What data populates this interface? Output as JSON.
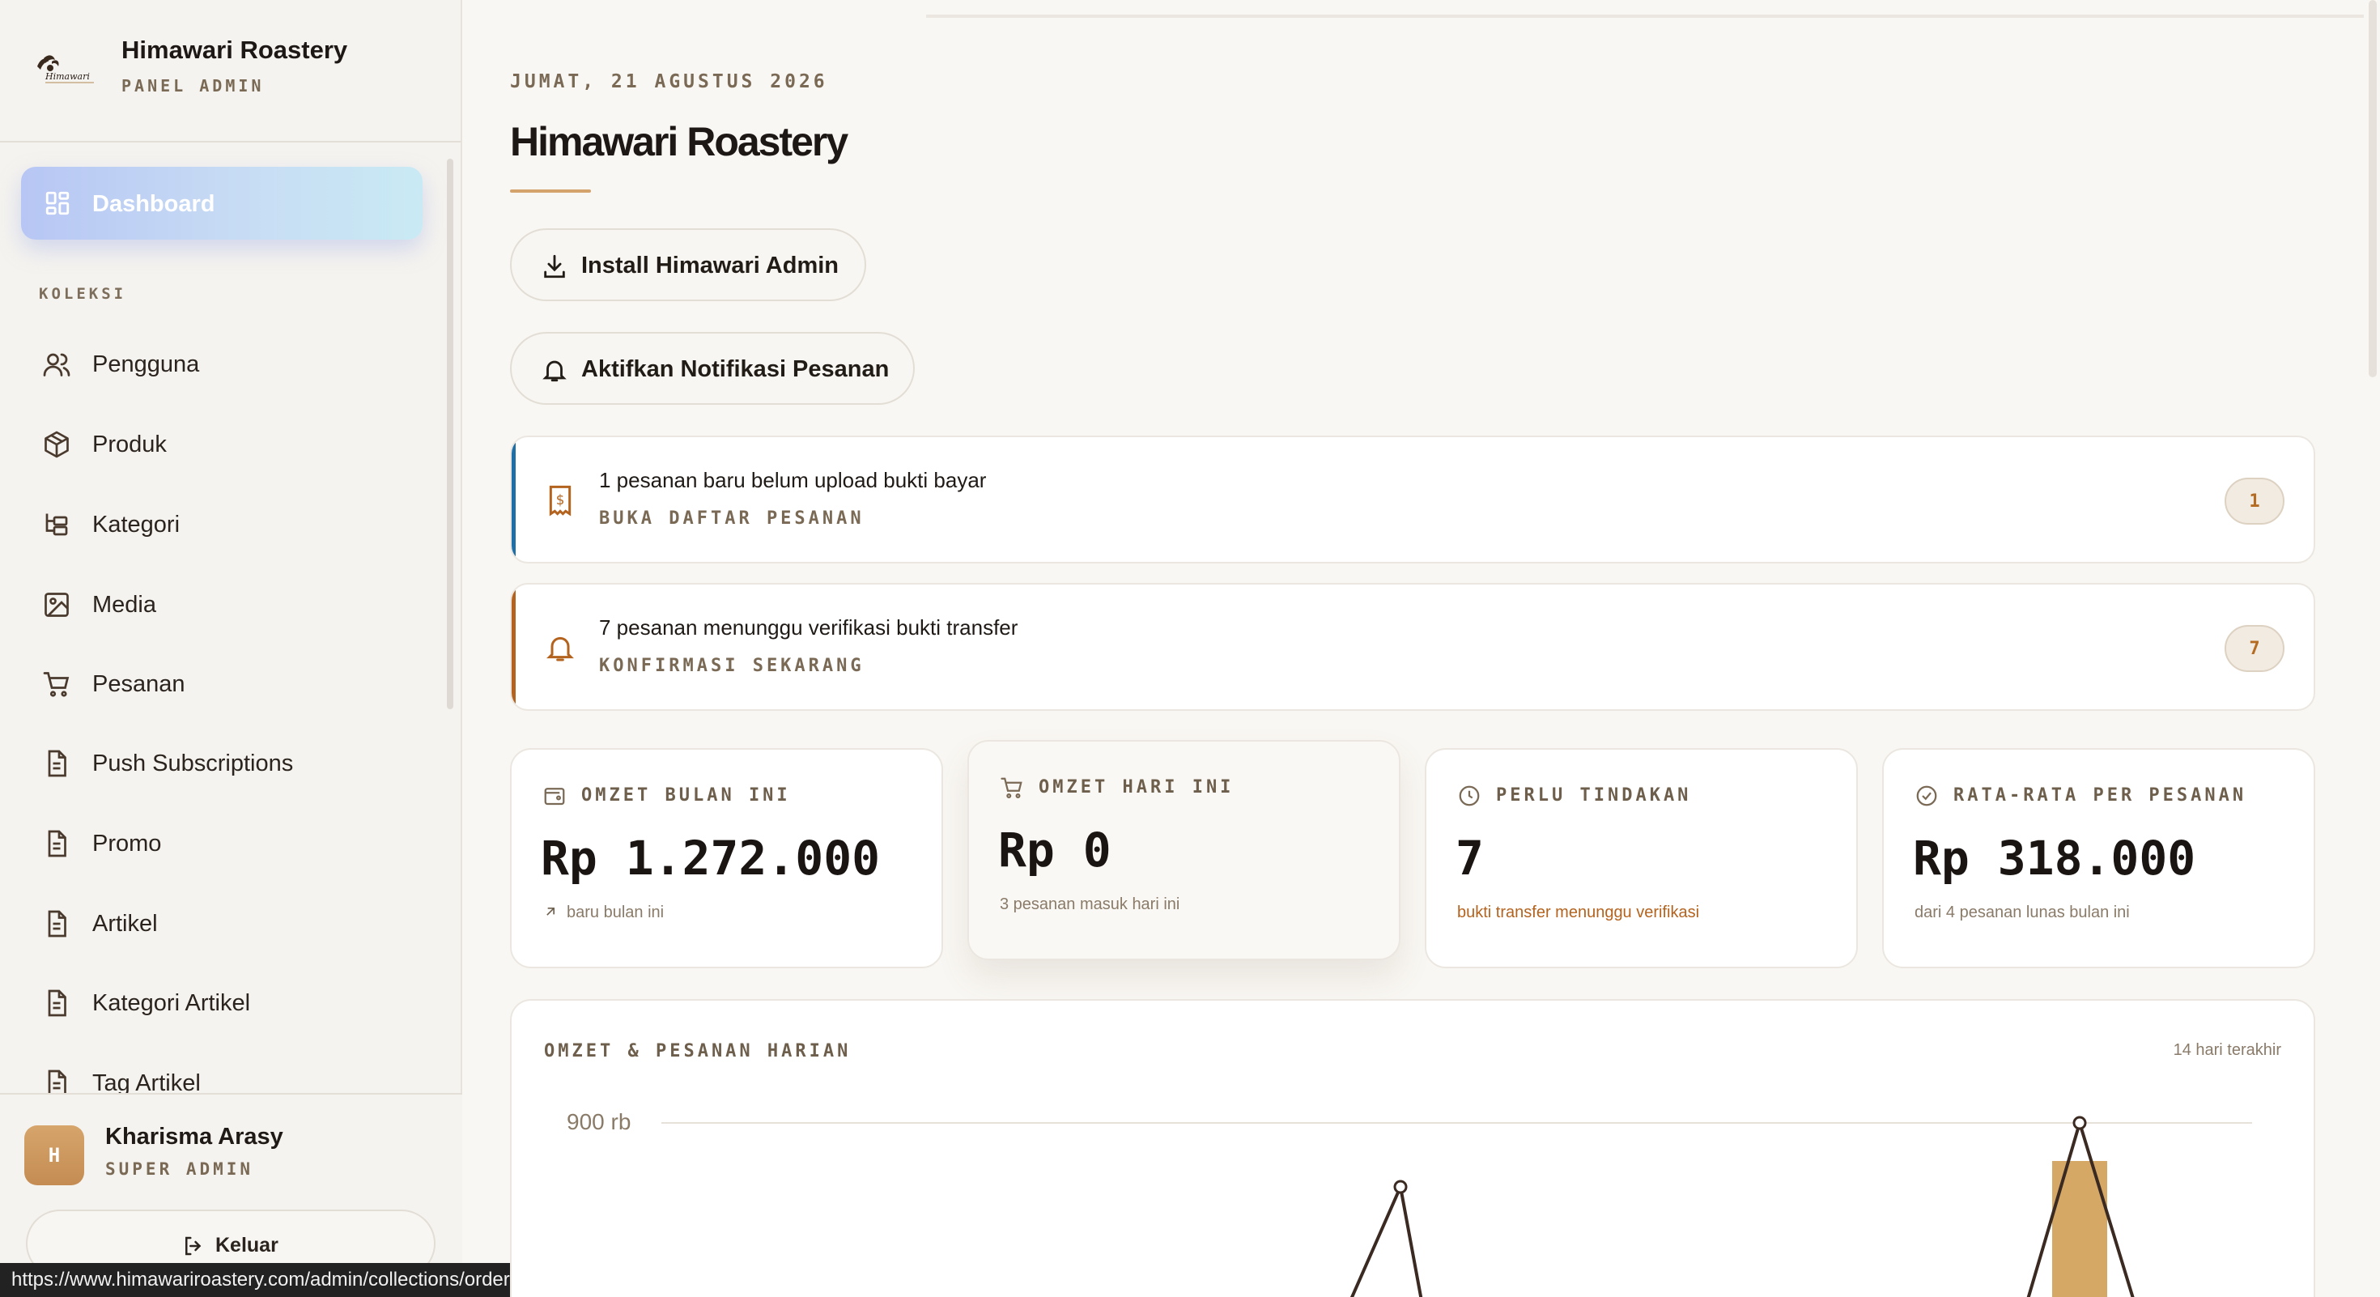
{
  "brand": {
    "title": "Himawari Roastery",
    "subtitle": "PANEL ADMIN",
    "logo_text": "Himawari"
  },
  "nav": {
    "active": {
      "label": "Dashboard",
      "icon": "dashboard-grid-icon"
    },
    "section_label": "KOLEKSI",
    "items": [
      {
        "label": "Pengguna",
        "icon": "users-icon"
      },
      {
        "label": "Produk",
        "icon": "package-icon"
      },
      {
        "label": "Kategori",
        "icon": "folder-tree-icon"
      },
      {
        "label": "Media",
        "icon": "image-icon"
      },
      {
        "label": "Pesanan",
        "icon": "cart-icon"
      },
      {
        "label": "Push Subscriptions",
        "icon": "document-icon"
      },
      {
        "label": "Promo",
        "icon": "document-icon"
      },
      {
        "label": "Artikel",
        "icon": "document-icon"
      },
      {
        "label": "Kategori Artikel",
        "icon": "document-icon"
      },
      {
        "label": "Tag Artikel",
        "icon": "document-icon"
      }
    ]
  },
  "user": {
    "initial": "H",
    "name": "Kharisma Arasy",
    "role": "SUPER ADMIN",
    "logout_label": "Keluar"
  },
  "status_bar_url": "https://www.himawariroastery.com/admin/collections/orders",
  "header": {
    "date": "JUMAT, 21 AGUSTUS 2026",
    "title": "Himawari Roastery"
  },
  "actions": {
    "install_label": "Install Himawari Admin",
    "notify_label": "Aktifkan Notifikasi Pesanan"
  },
  "alerts": [
    {
      "message": "1 pesanan baru belum upload bukti bayar",
      "action": "BUKA DAFTAR PESANAN",
      "count": "1",
      "accent": "#1e6fa8",
      "icon": "receipt-icon"
    },
    {
      "message": "7 pesanan menunggu verifikasi bukti transfer",
      "action": "KONFIRMASI SEKARANG",
      "count": "7",
      "accent": "#b4631f",
      "icon": "bell-icon"
    }
  ],
  "stats": [
    {
      "heading": "OMZET BULAN INI",
      "value": "Rp 1.272.000",
      "note": "baru bulan ini",
      "icon": "wallet-icon"
    },
    {
      "heading": "OMZET HARI INI",
      "value": "Rp 0",
      "note": "3 pesanan masuk hari ini",
      "icon": "cart-icon"
    },
    {
      "heading": "PERLU TINDAKAN",
      "value": "7",
      "note": "bukti transfer menunggu verifikasi",
      "icon": "clock-icon"
    },
    {
      "heading": "RATA-RATA PER PESANAN",
      "value": "Rp 318.000",
      "note": "dari 4 pesanan lunas bulan ini",
      "icon": "check-circle-icon"
    }
  ],
  "colors": {
    "accent_gold": "#d4a36b",
    "bar_fill": "#d6a866",
    "line_stroke": "#3a2a22",
    "nav_active_gradient": [
      "#b7c6f4",
      "#c9eaf4"
    ]
  },
  "chart": {
    "title": "OMZET & PESANAN HARIAN",
    "range_label": "14 hari terakhir",
    "y_tick_label": "900 rb"
  },
  "chart_data": {
    "type": "line",
    "title": "OMZET & PESANAN HARIAN",
    "subtitle": "14 hari terakhir",
    "y_tick_labels": [
      "900 rb"
    ],
    "visible_series": [
      {
        "type": "line",
        "peaks_visible": 2
      },
      {
        "type": "bar",
        "bars_visible": 1
      }
    ]
  }
}
